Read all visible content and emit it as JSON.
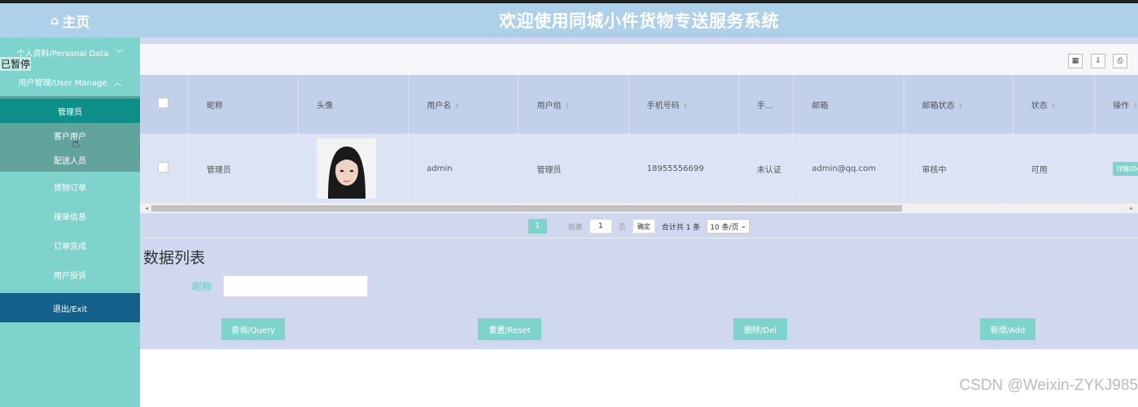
{
  "header": {
    "home_icon": "home-icon",
    "home_label": "主页",
    "title": "欢迎使用同城小件货物专送服务系统"
  },
  "overlay_text": "已暂停",
  "sidebar": {
    "group_personal": "个人资料/Personal Data",
    "group_user": "用户管理/User Manage",
    "sub_active": "管理员",
    "sub_items": [
      "客户用户",
      "配送人员"
    ],
    "items": [
      "货物订单",
      "接单信息",
      "订单完成",
      "用户投诉"
    ],
    "exit": "退出/Exit"
  },
  "toolbar": {
    "icons": [
      "columns-icon",
      "export-icon",
      "print-icon"
    ]
  },
  "table": {
    "headers": [
      "昵称",
      "头像",
      "用户名",
      "用户组",
      "手机号码",
      "手…",
      "邮箱",
      "邮箱状态",
      "状态",
      "操作"
    ],
    "rows": [
      {
        "nickname": "管理员",
        "username": "admin",
        "group": "管理员",
        "phone": "18955556699",
        "phone_status": "未认证",
        "email": "admin@qq.com",
        "email_status": "审核中",
        "status": "可用",
        "action": "详情/Detail"
      }
    ]
  },
  "pagination": {
    "current": "1",
    "goto_label": "到第",
    "page_input": "1",
    "page_unit": "页",
    "confirm": "确定",
    "total": "合计共 1 条",
    "page_size": "10 条/页"
  },
  "search": {
    "section_title": "数据列表",
    "label": "昵称",
    "placeholder": "",
    "buttons": {
      "query": "查询/Query",
      "reset": "重置/Reset",
      "delete": "删除/Del",
      "add": "新增/Add"
    }
  },
  "watermark": "CSDN @Weixin-ZYKJ985",
  "colors": {
    "accent": "#7fd3cd",
    "header": "#aed0e8",
    "active": "#0e9088",
    "exit": "#13618a"
  }
}
